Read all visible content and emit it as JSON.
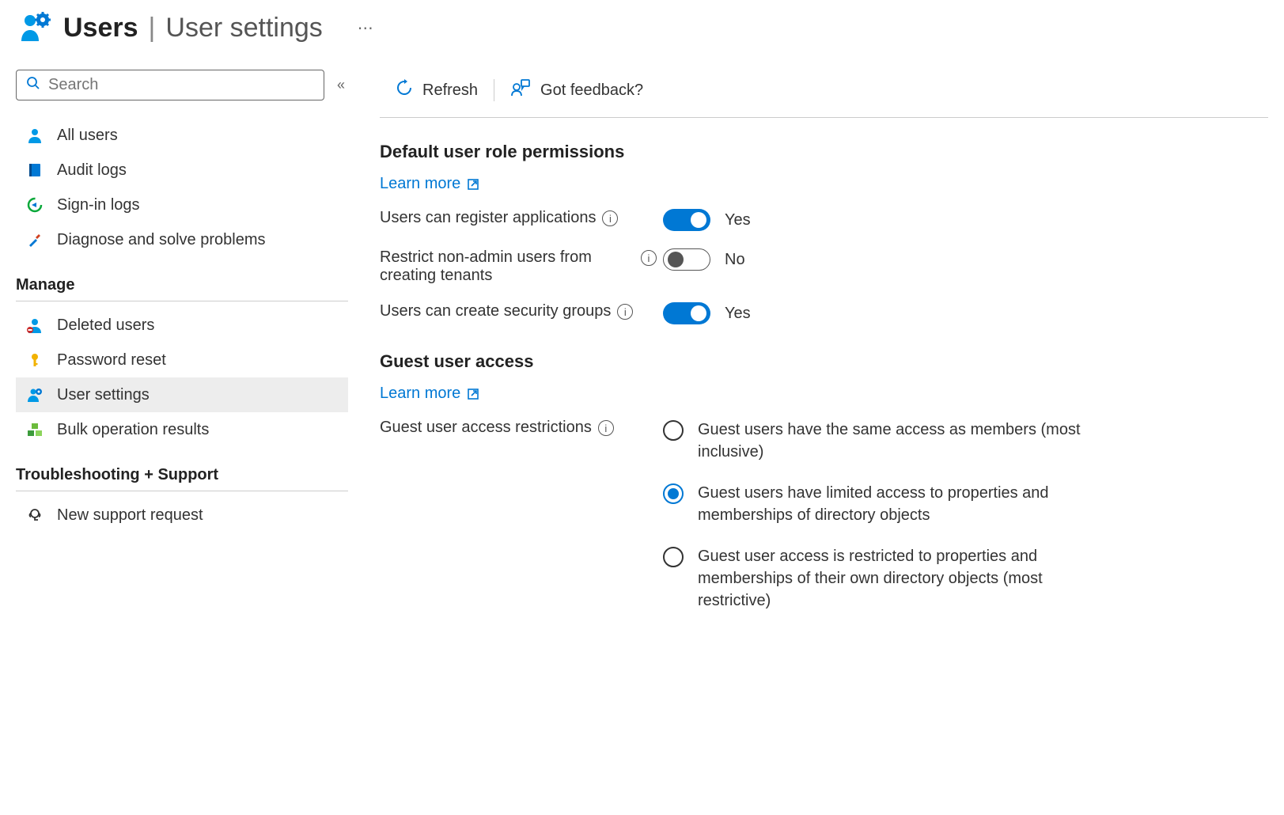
{
  "header": {
    "title_bold": "Users",
    "title_thin": "User settings"
  },
  "search": {
    "placeholder": "Search"
  },
  "sidebar": {
    "items_top": [
      {
        "label": "All users",
        "icon": "user"
      },
      {
        "label": "Audit logs",
        "icon": "book"
      },
      {
        "label": "Sign-in logs",
        "icon": "signin"
      },
      {
        "label": "Diagnose and solve problems",
        "icon": "tools"
      }
    ],
    "section_manage": "Manage",
    "items_manage": [
      {
        "label": "Deleted users",
        "icon": "user-del"
      },
      {
        "label": "Password reset",
        "icon": "key"
      },
      {
        "label": "User settings",
        "icon": "user-gear",
        "selected": true
      },
      {
        "label": "Bulk operation results",
        "icon": "blocks"
      }
    ],
    "section_support": "Troubleshooting + Support",
    "items_support": [
      {
        "label": "New support request",
        "icon": "support"
      }
    ]
  },
  "toolbar": {
    "refresh": "Refresh",
    "feedback": "Got feedback?"
  },
  "sections": {
    "default_permissions": {
      "heading": "Default user role permissions",
      "learn_more": "Learn more",
      "register_apps": {
        "label": "Users can register applications",
        "value": "Yes",
        "on": true
      },
      "restrict_tenants": {
        "label": "Restrict non-admin users from creating tenants",
        "value": "No",
        "on": false
      },
      "create_groups": {
        "label": "Users can create security groups",
        "value": "Yes",
        "on": true
      }
    },
    "guest_access": {
      "heading": "Guest user access",
      "learn_more": "Learn more",
      "restrictions_label": "Guest user access restrictions",
      "options": [
        {
          "text": "Guest users have the same access as members (most inclusive)",
          "selected": false
        },
        {
          "text": "Guest users have limited access to properties and memberships of directory objects",
          "selected": true
        },
        {
          "text": "Guest user access is restricted to properties and memberships of their own directory objects (most restrictive)",
          "selected": false
        }
      ]
    }
  }
}
